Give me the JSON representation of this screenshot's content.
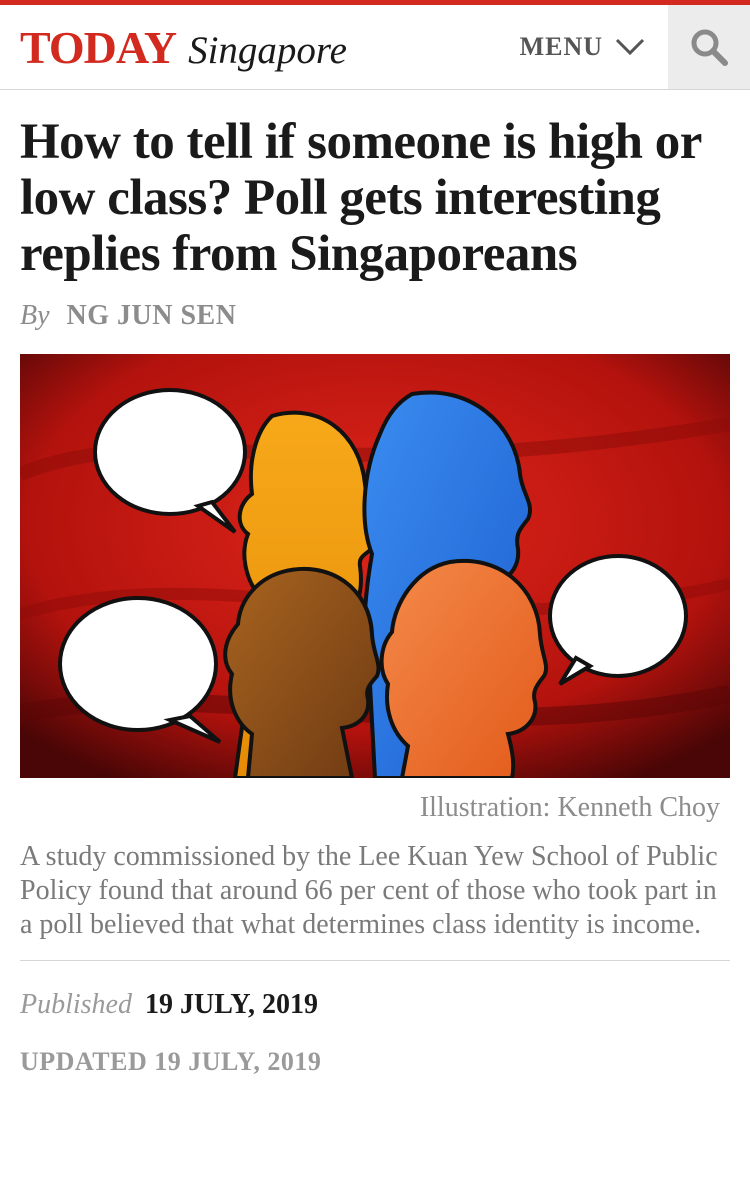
{
  "header": {
    "brand_name": "TODAY",
    "brand_region": "Singapore",
    "menu_label": "MENU",
    "accent_color": "#d22a1f",
    "menu_icon": "chevron-down-icon",
    "search_icon": "search-icon"
  },
  "article": {
    "headline": "How to tell if someone is high or low class? Poll gets interesting replies from Singaporeans",
    "byline_prefix": "By",
    "author": "NG JUN SEN",
    "image_alt": "Colourful silhouettes of heads with speech bubbles on red background",
    "image_credit": "Illustration: Kenneth Choy",
    "summary": "A study commissioned by the Lee Kuan Yew School of Public Policy found that around 66 per cent of those who took part in a poll believed that what determines class identity is income.",
    "published_label": "Published",
    "published_date": "19 JULY, 2019",
    "updated_text": "UPDATED 19 JULY, 2019"
  }
}
